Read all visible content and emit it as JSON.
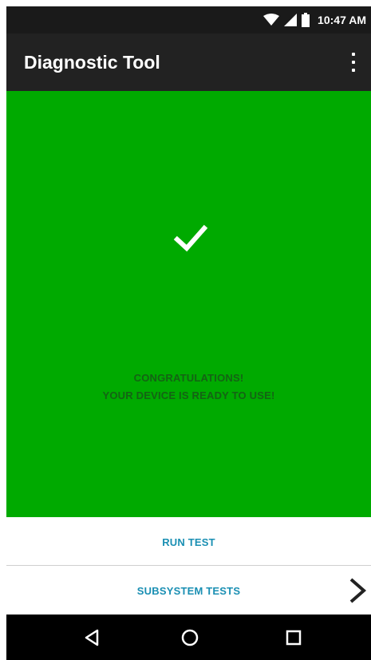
{
  "status_bar": {
    "time": "10:47 AM",
    "icons": [
      "wifi-icon",
      "cell-signal-icon",
      "battery-icon"
    ]
  },
  "app_bar": {
    "title": "Diagnostic Tool",
    "menu_icon": "overflow-menu-icon"
  },
  "result": {
    "icon": "checkmark-icon",
    "line1": "CONGRATULATIONS!",
    "line2": "YOUR DEVICE IS READY TO USE!",
    "background_color": "#00aa00",
    "text_color": "#146314"
  },
  "buttons": {
    "run_test": "RUN TEST",
    "subsystem_tests": "SUBSYSTEM TESTS",
    "label_color": "#1a8fb3"
  },
  "nav_bar": {
    "icons": [
      "back-icon",
      "home-icon",
      "recents-icon"
    ]
  }
}
